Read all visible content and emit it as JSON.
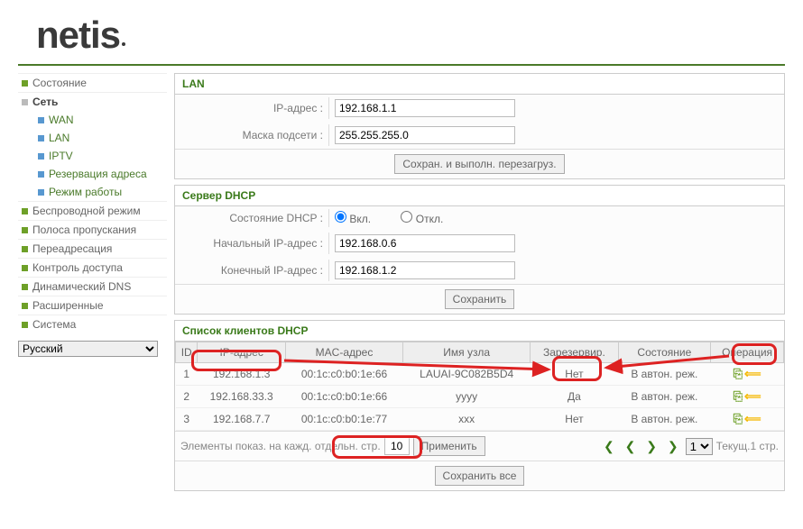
{
  "logo": "netis",
  "sidebar": {
    "items": [
      {
        "label": "Состояние"
      },
      {
        "label": "Сеть"
      },
      {
        "label": "WAN"
      },
      {
        "label": "LAN"
      },
      {
        "label": "IPTV"
      },
      {
        "label": "Резервация адреса"
      },
      {
        "label": "Режим работы"
      },
      {
        "label": "Беспроводной режим"
      },
      {
        "label": "Полоса пропускания"
      },
      {
        "label": "Переадресация"
      },
      {
        "label": "Контроль доступа"
      },
      {
        "label": "Динамический DNS"
      },
      {
        "label": "Расширенные"
      },
      {
        "label": "Система"
      }
    ],
    "language": "Русский"
  },
  "lan": {
    "title": "LAN",
    "ip_label": "IP-адрес :",
    "ip_value": "192.168.1.1",
    "mask_label": "Маска подсети :",
    "mask_value": "255.255.255.0",
    "save_btn": "Сохран. и выполн. перезагруз."
  },
  "dhcp": {
    "title": "Сервер DHCP",
    "state_label": "Состояние DHCP :",
    "on": "Вкл.",
    "off": "Откл.",
    "start_label": "Начальный IP-адрес :",
    "start_value": "192.168.0.6",
    "end_label": "Конечный IP-адрес :",
    "end_value": "192.168.1.2",
    "save_btn": "Сохранить"
  },
  "clients": {
    "title": "Список клиентов DHCP",
    "headers": {
      "id": "ID",
      "ip": "IP-адрес",
      "mac": "MAC-адрес",
      "host": "Имя узла",
      "res": "Зарезервир.",
      "state": "Состояние",
      "op": "Операция"
    },
    "rows": [
      {
        "id": "1",
        "ip": "192.168.1.3",
        "mac": "00:1c:c0:b0:1e:66",
        "host": "LAUAI-9C082B5D4",
        "res": "Нет",
        "state": "В автон. реж."
      },
      {
        "id": "2",
        "ip": "192.168.33.3",
        "mac": "00:1c:c0:b0:1e:66",
        "host": "yyyy",
        "res": "Да",
        "state": "В автон. реж."
      },
      {
        "id": "3",
        "ip": "192.168.7.7",
        "mac": "00:1c:c0:b0:1e:77",
        "host": "xxx",
        "res": "Нет",
        "state": "В автон. реж."
      }
    ],
    "pager_label": "Элементы показ. на кажд. отдельн. стр.",
    "per_page": "10",
    "apply": "Применить",
    "page_sel": "1",
    "page_info": "Текущ.1 стр.",
    "save_all": "Сохранить все"
  }
}
